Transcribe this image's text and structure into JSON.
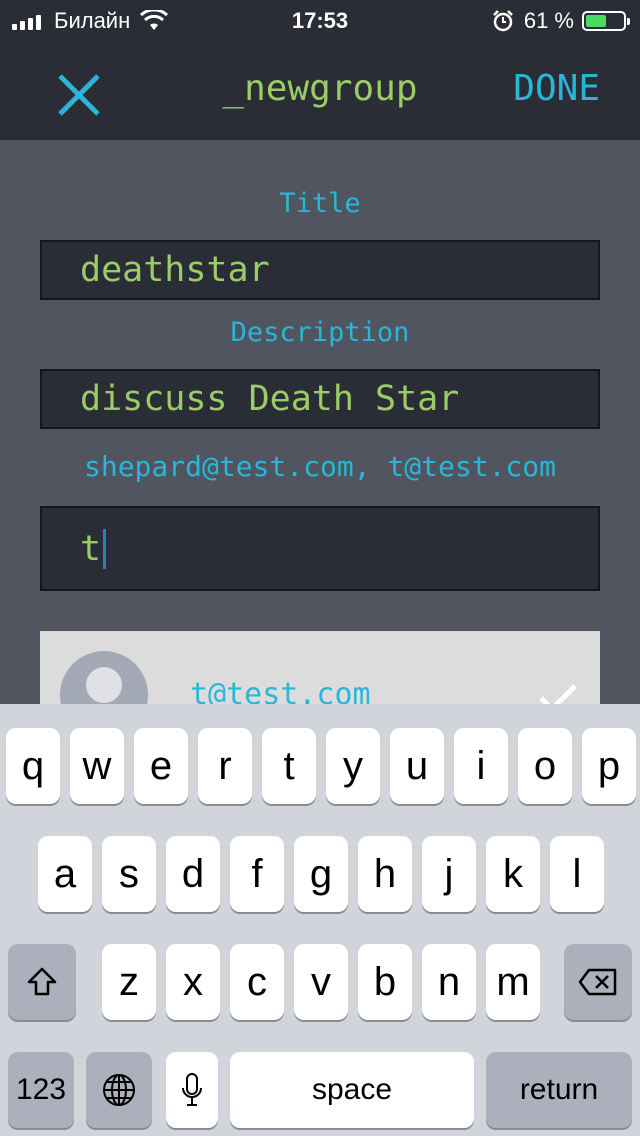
{
  "status_bar": {
    "carrier": "Билайн",
    "time": "17:53",
    "battery_text": "61 %",
    "battery_level": 0.61,
    "icons": [
      "signal-icon",
      "wifi-icon",
      "alarm-icon",
      "battery-icon"
    ]
  },
  "nav": {
    "title": "_newgroup",
    "close_icon": "close-icon",
    "done_label": "DONE"
  },
  "form": {
    "title_label": "Title",
    "title_value": "deathstar",
    "description_label": "Description",
    "description_value": "discuss Death Star",
    "members_text": "shepard@test.com, t@test.com",
    "member_search_value": "t"
  },
  "suggestion": {
    "email": "t@test.com",
    "avatar_icon": "user-avatar-icon",
    "check_icon": "checkmark-icon"
  },
  "keyboard": {
    "row1": [
      "q",
      "w",
      "e",
      "r",
      "t",
      "y",
      "u",
      "i",
      "o",
      "p"
    ],
    "row2": [
      "a",
      "s",
      "d",
      "f",
      "g",
      "h",
      "j",
      "k",
      "l"
    ],
    "row3": [
      "z",
      "x",
      "c",
      "v",
      "b",
      "n",
      "m"
    ],
    "numbers_label": "123",
    "space_label": "space",
    "return_label": "return",
    "shift_icon": "shift-icon",
    "delete_icon": "backspace-icon",
    "globe_icon": "globe-icon",
    "mic_icon": "microphone-icon"
  },
  "colors": {
    "accent": "#29b6d8",
    "text_green": "#9ccc65",
    "background_dark": "#2a2d35",
    "content_gray": "#50555f"
  }
}
